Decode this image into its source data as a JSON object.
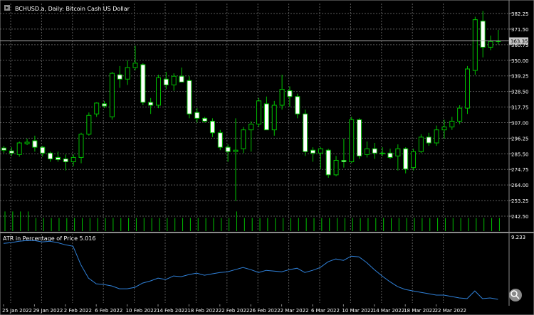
{
  "chart_data": [
    {
      "type": "candlestick",
      "title": "BCHUSD.a, Daily: Bitcoin Cash US Dollar",
      "current_price_label": "363.35",
      "y_ticks": [
        "382.25",
        "371.50",
        "360.75",
        "350.00",
        "339.25",
        "328.50",
        "317.75",
        "307.00",
        "296.25",
        "285.50",
        "274.75",
        "264.00",
        "253.25",
        "242.50"
      ],
      "ylim": [
        242.5,
        382.25
      ],
      "current_price": 363.35,
      "x_labels": [
        "25 Jan 2022",
        "29 Jan 2022",
        "2 Feb 2022",
        "6 Feb 2022",
        "10 Feb 2022",
        "14 Feb 2022",
        "18 Feb 2022",
        "22 Feb 2022",
        "26 Feb 2022",
        "2 Mar 2022",
        "6 Mar 2022",
        "10 Mar 2022",
        "14 Mar 2022",
        "18 Mar 2022",
        "22 Mar 2022"
      ],
      "x_label_candle_index": [
        0,
        4,
        8,
        12,
        16,
        20,
        24,
        28,
        32,
        36,
        40,
        44,
        48,
        52,
        56
      ],
      "candles": [
        {
          "o": 289.5,
          "h": 291,
          "l": 286,
          "c": 288
        },
        {
          "o": 287.5,
          "h": 290,
          "l": 284,
          "c": 286
        },
        {
          "o": 285,
          "h": 294,
          "l": 283.5,
          "c": 293
        },
        {
          "o": 292.5,
          "h": 296,
          "l": 291.5,
          "c": 293.5
        },
        {
          "o": 294.5,
          "h": 298,
          "l": 287,
          "c": 290
        },
        {
          "o": 290,
          "h": 291,
          "l": 283.5,
          "c": 286
        },
        {
          "o": 286,
          "h": 287,
          "l": 280,
          "c": 282
        },
        {
          "o": 283,
          "h": 287,
          "l": 280,
          "c": 281.5
        },
        {
          "o": 282,
          "h": 285,
          "l": 274,
          "c": 280
        },
        {
          "o": 280,
          "h": 285,
          "l": 277,
          "c": 283
        },
        {
          "o": 283,
          "h": 300,
          "l": 279,
          "c": 299
        },
        {
          "o": 299,
          "h": 314,
          "l": 298,
          "c": 312
        },
        {
          "o": 313,
          "h": 321,
          "l": 311,
          "c": 320.5
        },
        {
          "o": 320,
          "h": 322,
          "l": 317,
          "c": 318.5
        },
        {
          "o": 311,
          "h": 342,
          "l": 309,
          "c": 341
        },
        {
          "o": 340,
          "h": 346,
          "l": 331,
          "c": 337
        },
        {
          "o": 337,
          "h": 350,
          "l": 333,
          "c": 345
        },
        {
          "o": 345,
          "h": 360,
          "l": 343,
          "c": 348
        },
        {
          "o": 347,
          "h": 348,
          "l": 319,
          "c": 321
        },
        {
          "o": 321,
          "h": 324,
          "l": 313,
          "c": 319
        },
        {
          "o": 319,
          "h": 340,
          "l": 317,
          "c": 338
        },
        {
          "o": 337,
          "h": 342,
          "l": 330,
          "c": 333
        },
        {
          "o": 333,
          "h": 341,
          "l": 329,
          "c": 339
        },
        {
          "o": 339,
          "h": 345,
          "l": 336,
          "c": 335
        },
        {
          "o": 336,
          "h": 339,
          "l": 310,
          "c": 313
        },
        {
          "o": 314,
          "h": 317,
          "l": 307,
          "c": 310
        },
        {
          "o": 310,
          "h": 311,
          "l": 307,
          "c": 308
        },
        {
          "o": 308,
          "h": 310,
          "l": 297,
          "c": 300
        },
        {
          "o": 300,
          "h": 302,
          "l": 288,
          "c": 290
        },
        {
          "o": 290,
          "h": 292,
          "l": 280,
          "c": 287
        },
        {
          "o": 287,
          "h": 310,
          "l": 253,
          "c": 288
        },
        {
          "o": 289,
          "h": 304,
          "l": 286,
          "c": 302
        },
        {
          "o": 302,
          "h": 308,
          "l": 287,
          "c": 306
        },
        {
          "o": 306,
          "h": 324,
          "l": 304,
          "c": 322
        },
        {
          "o": 320,
          "h": 325,
          "l": 315,
          "c": 302
        },
        {
          "o": 302,
          "h": 322,
          "l": 298,
          "c": 319
        },
        {
          "o": 319,
          "h": 340,
          "l": 316,
          "c": 330
        },
        {
          "o": 329,
          "h": 332,
          "l": 318,
          "c": 325
        },
        {
          "o": 325,
          "h": 327,
          "l": 310,
          "c": 313
        },
        {
          "o": 313,
          "h": 316,
          "l": 284,
          "c": 287
        },
        {
          "o": 288,
          "h": 290,
          "l": 280,
          "c": 286
        },
        {
          "o": 286,
          "h": 290,
          "l": 275,
          "c": 289
        },
        {
          "o": 288,
          "h": 289,
          "l": 269,
          "c": 271
        },
        {
          "o": 271,
          "h": 284,
          "l": 270,
          "c": 281
        },
        {
          "o": 281,
          "h": 296,
          "l": 276,
          "c": 280
        },
        {
          "o": 280,
          "h": 311,
          "l": 279,
          "c": 309
        },
        {
          "o": 309,
          "h": 310,
          "l": 282,
          "c": 284
        },
        {
          "o": 285,
          "h": 294,
          "l": 283,
          "c": 289
        },
        {
          "o": 289,
          "h": 293,
          "l": 282,
          "c": 286
        },
        {
          "o": 286,
          "h": 290,
          "l": 284,
          "c": 286
        },
        {
          "o": 286,
          "h": 289,
          "l": 282,
          "c": 283
        },
        {
          "o": 284,
          "h": 292,
          "l": 274,
          "c": 289
        },
        {
          "o": 289,
          "h": 290,
          "l": 272,
          "c": 275
        },
        {
          "o": 276,
          "h": 289,
          "l": 274,
          "c": 287
        },
        {
          "o": 287,
          "h": 299,
          "l": 286,
          "c": 297
        },
        {
          "o": 297,
          "h": 300,
          "l": 291,
          "c": 293
        },
        {
          "o": 293,
          "h": 305,
          "l": 291,
          "c": 302
        },
        {
          "o": 302,
          "h": 309,
          "l": 296,
          "c": 304
        },
        {
          "o": 304,
          "h": 311,
          "l": 302,
          "c": 308
        },
        {
          "o": 308,
          "h": 319,
          "l": 306,
          "c": 317
        },
        {
          "o": 317,
          "h": 346,
          "l": 313,
          "c": 344
        },
        {
          "o": 343,
          "h": 380,
          "l": 340,
          "c": 378
        },
        {
          "o": 377,
          "h": 384,
          "l": 352,
          "c": 359
        },
        {
          "o": 359,
          "h": 367,
          "l": 357,
          "c": 363
        },
        {
          "o": 363,
          "h": 371,
          "l": 361,
          "c": 363.35
        }
      ],
      "volumes": [
        12,
        12,
        12,
        12,
        8,
        8,
        8,
        8,
        8,
        8,
        8,
        8,
        8,
        8,
        8,
        8,
        8,
        8,
        8,
        8,
        8,
        8,
        8,
        8,
        8,
        8,
        8,
        8,
        8,
        8,
        12,
        8,
        8,
        8,
        8,
        8,
        8,
        8,
        8,
        8,
        8,
        8,
        8,
        8,
        8,
        8,
        8,
        8,
        8,
        8,
        8,
        8,
        8,
        8,
        8,
        8,
        8,
        8,
        8,
        8,
        8,
        8,
        8,
        8,
        8
      ],
      "colors": {
        "bull": "#ffffff",
        "bear": "#000000",
        "outline": "#00c000",
        "grid": "#5a5a5a",
        "axis_text": "#ffffff",
        "price_line": "#b0b0b0",
        "price_label_bg": "#c8c8c8"
      }
    },
    {
      "type": "line",
      "title": "ATR in Percentage of Price 5.016",
      "y_max_label": "9.233",
      "y_max": 9.233,
      "y_min": 0,
      "values": [
        8.3,
        8.4,
        8.6,
        8.7,
        8.7,
        8.5,
        8.6,
        8.4,
        8.1,
        7.9,
        5.3,
        3.4,
        2.6,
        2.5,
        2.3,
        1.9,
        1.9,
        2.1,
        2.7,
        3.0,
        3.4,
        3.2,
        3.7,
        3.6,
        3.9,
        4.1,
        3.8,
        4.0,
        4.2,
        4.3,
        4.6,
        4.9,
        4.6,
        4.2,
        4.5,
        4.4,
        4.3,
        4.6,
        4.8,
        4.2,
        4.5,
        4.9,
        5.7,
        6.1,
        5.9,
        6.5,
        6.4,
        5.6,
        4.6,
        3.7,
        2.9,
        2.2,
        1.8,
        1.6,
        1.4,
        1.2,
        1.0,
        1.0,
        0.8,
        0.6,
        0.5,
        1.6,
        0.5,
        0.6,
        0.4
      ],
      "color": "#2f80d8"
    }
  ]
}
